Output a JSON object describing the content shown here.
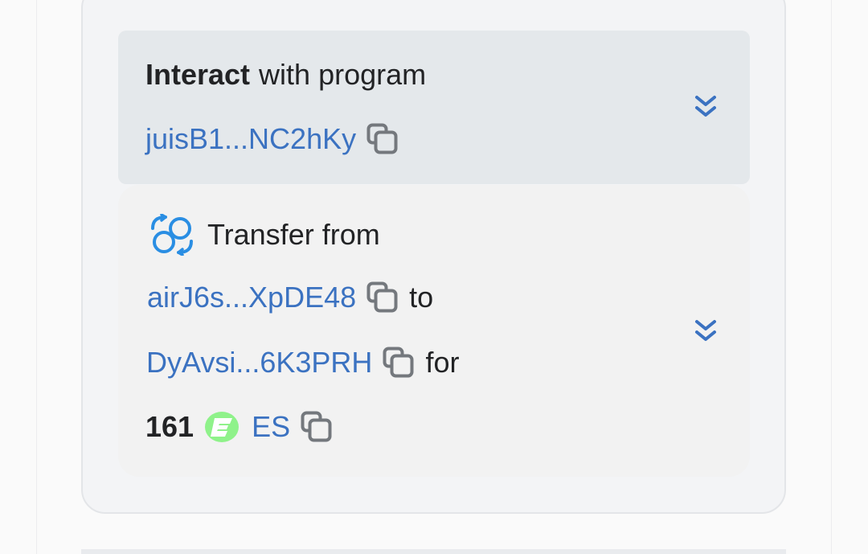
{
  "header": {
    "interact_label": "Interact",
    "with_program_label": "with program",
    "program_address": "juisB1...NC2hKy"
  },
  "transfer": {
    "title": "Transfer from",
    "from_address": "airJ6s...XpDE48",
    "to_label": "to",
    "to_address": "DyAvsi...6K3PRH",
    "for_label": "for",
    "amount": "161",
    "token_symbol": "ES"
  },
  "icons": {
    "copy": "copy-icon",
    "expand": "chevrons-down-icon",
    "transfer": "transfer-icon",
    "token": "es-token-logo"
  },
  "colors": {
    "link": "#3b72c1",
    "token_green": "#8ff28a",
    "transfer_icon": "#2a8ee3",
    "header_bg": "#e4e8eb"
  }
}
